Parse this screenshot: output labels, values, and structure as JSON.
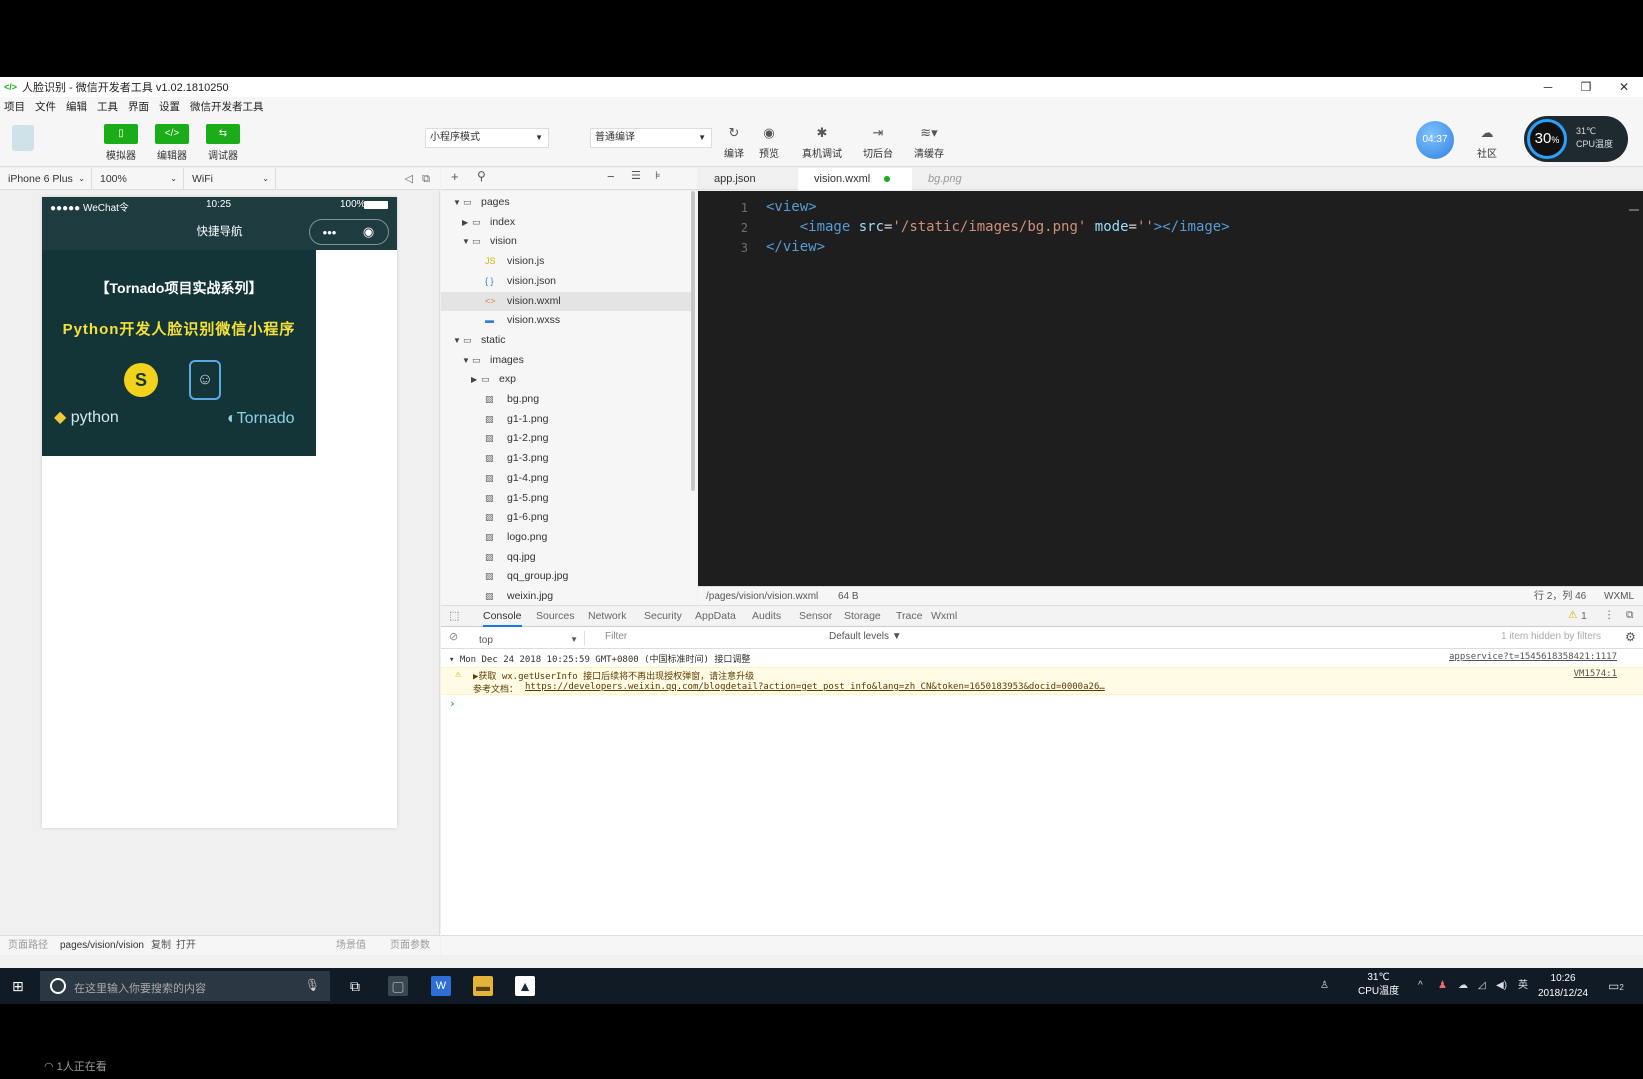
{
  "window": {
    "title": "人脸识别 - 微信开发者工具 v1.02.1810250",
    "controls": [
      "─",
      "❐",
      "✕"
    ]
  },
  "menu": [
    "项目",
    "文件",
    "编辑",
    "工具",
    "界面",
    "设置",
    "微信开发者工具"
  ],
  "toolbar": {
    "simulator_label": "模拟器",
    "editor_label": "编辑器",
    "debugger_label": "调试器",
    "mode_select": "小程序模式",
    "compile_select": "普通编译",
    "compile_label": "编译",
    "preview_label": "预览",
    "remote_debug_label": "真机调试",
    "background_label": "切后台",
    "clear_cache_label": "清缓存",
    "badge_time": "04:37",
    "community_label": "社区",
    "cpu_percent": "30",
    "cpu_percent_unit": "%",
    "cpu_temp": "31℃",
    "cpu_temp_label": "CPU温度"
  },
  "simulator": {
    "device": "iPhone 6 Plus",
    "zoom": "100%",
    "network": "WiFi",
    "phone": {
      "carrier": "●●●●● WeChat令",
      "time": "10:25",
      "battery": "100%",
      "nav_title": "快捷导航",
      "capsule_more": "•••",
      "capsule_close": "◉",
      "banner_title": "【Tornado项目实战系列】",
      "banner_subtitle": "Python开发人脸识别微信小程序",
      "python_text": "python",
      "tornado_text": "Tornado"
    },
    "footer": {
      "path_label": "页面路径",
      "path": "pages/vision/vision",
      "copy": "复制",
      "open": "打开",
      "scene_label": "场景值",
      "params_label": "页面参数"
    }
  },
  "file_tree": [
    {
      "name": "pages",
      "depth": 0,
      "type": "folder",
      "open": true
    },
    {
      "name": "index",
      "depth": 1,
      "type": "folder",
      "open": false
    },
    {
      "name": "vision",
      "depth": 1,
      "type": "folder",
      "open": true
    },
    {
      "name": "vision.js",
      "depth": 2,
      "type": "js"
    },
    {
      "name": "vision.json",
      "depth": 2,
      "type": "json"
    },
    {
      "name": "vision.wxml",
      "depth": 2,
      "type": "wxml",
      "selected": true
    },
    {
      "name": "vision.wxss",
      "depth": 2,
      "type": "wxss"
    },
    {
      "name": "static",
      "depth": 0,
      "type": "folder",
      "open": true
    },
    {
      "name": "images",
      "depth": 1,
      "type": "folder",
      "open": true
    },
    {
      "name": "exp",
      "depth": 2,
      "type": "folder",
      "open": false
    },
    {
      "name": "bg.png",
      "depth": 2,
      "type": "image"
    },
    {
      "name": "g1-1.png",
      "depth": 2,
      "type": "image"
    },
    {
      "name": "g1-2.png",
      "depth": 2,
      "type": "image"
    },
    {
      "name": "g1-3.png",
      "depth": 2,
      "type": "image"
    },
    {
      "name": "g1-4.png",
      "depth": 2,
      "type": "image"
    },
    {
      "name": "g1-5.png",
      "depth": 2,
      "type": "image"
    },
    {
      "name": "g1-6.png",
      "depth": 2,
      "type": "image"
    },
    {
      "name": "logo.png",
      "depth": 2,
      "type": "image"
    },
    {
      "name": "qq.jpg",
      "depth": 2,
      "type": "image"
    },
    {
      "name": "qq_group.jpg",
      "depth": 2,
      "type": "image"
    },
    {
      "name": "weixin.jpg",
      "depth": 2,
      "type": "image"
    }
  ],
  "editor": {
    "tabs": [
      {
        "label": "app.json",
        "state": "normal"
      },
      {
        "label": "vision.wxml",
        "state": "active",
        "modified": true
      },
      {
        "label": "bg.png",
        "state": "preview"
      }
    ],
    "lines": [
      {
        "num": "1",
        "parts": [
          [
            "tag",
            "<view>"
          ]
        ]
      },
      {
        "num": "2",
        "parts": [
          [
            "text",
            "    "
          ],
          [
            "tag",
            "<image"
          ],
          [
            "text",
            " "
          ],
          [
            "attr",
            "src"
          ],
          [
            "text",
            "="
          ],
          [
            "str",
            "'/static/images/bg.png'"
          ],
          [
            "text",
            " "
          ],
          [
            "attr",
            "mode"
          ],
          [
            "text",
            "="
          ],
          [
            "str",
            "''"
          ],
          [
            "tag",
            "></image>"
          ]
        ]
      },
      {
        "num": "3",
        "parts": [
          [
            "tag",
            "</view>"
          ]
        ]
      }
    ],
    "status": {
      "path": "/pages/vision/vision.wxml",
      "size": "64 B",
      "position": "行 2，列 46",
      "language": "WXML"
    }
  },
  "devtools": {
    "tabs": [
      "Console",
      "Sources",
      "Network",
      "Security",
      "AppData",
      "Audits",
      "Sensor",
      "Storage",
      "Trace",
      "Wxml"
    ],
    "active_tab": "Console",
    "warning_count": "1",
    "context": "top",
    "filter_placeholder": "Filter",
    "levels": "Default levels ▼",
    "hidden_note": "1 item hidden by filters",
    "group_header": "Mon Dec 24 2018 10:25:59 GMT+0800 (中国标准时间) 接口调整",
    "group_source": "appservice?t=1545618358421:1117",
    "warning_text": "▶获取 wx.getUserInfo 接口后续将不再出现授权弹窗，请注意升级",
    "doc_label": "参考文档：",
    "doc_link": "https://developers.weixin.qq.com/blogdetail?action=get_post_info&lang=zh_CN&token=1650183953&docid=0000a26…",
    "warning_source": "VM1574:1",
    "prompt": "›"
  },
  "taskbar": {
    "search_placeholder": "在这里输入你要搜索的内容",
    "cpu_temp": "31℃",
    "cpu_label": "CPU温度",
    "ime": "英",
    "time": "10:26",
    "date": "2018/12/24",
    "notification_count": "2"
  },
  "overlay": {
    "watching": "1人正在看"
  }
}
